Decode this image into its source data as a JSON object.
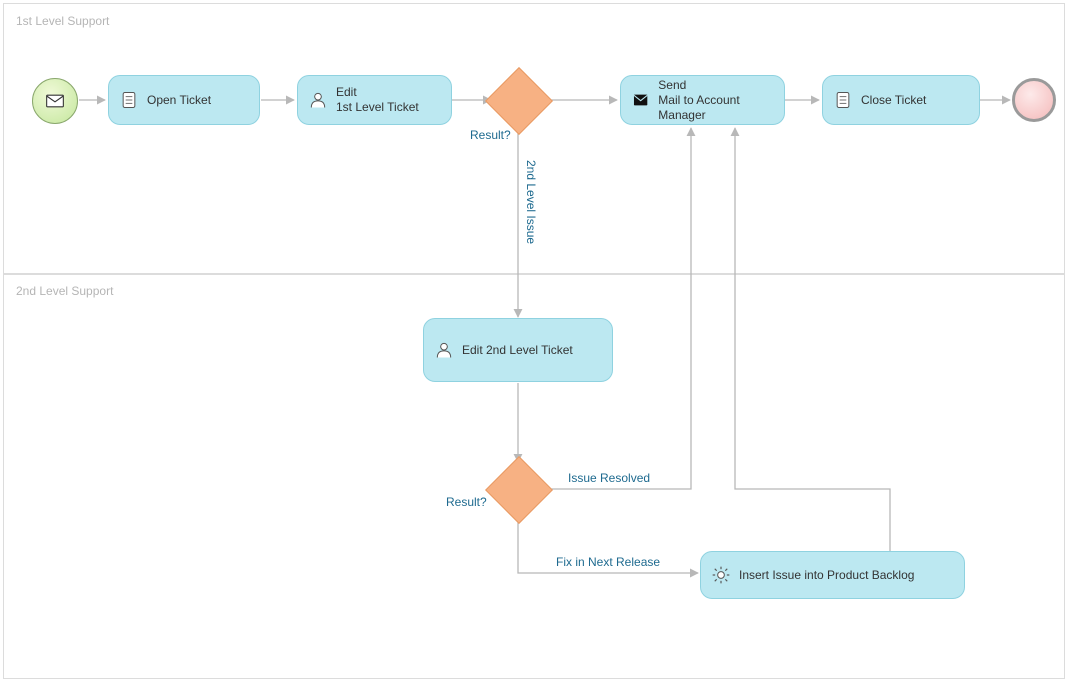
{
  "lanes": {
    "lane1": "1st Level Support",
    "lane2": "2nd Level Support"
  },
  "tasks": {
    "openTicket": "Open Ticket",
    "edit1st": "Edit\n1st Level Ticket",
    "sendMail": "Send\nMail to Account Manager",
    "closeTicket": "Close Ticket",
    "edit2nd": "Edit 2nd Level Ticket",
    "insertBacklog": "Insert Issue into Product Backlog"
  },
  "gateways": {
    "result1": "Result?",
    "result2": "Result?"
  },
  "flowLabels": {
    "secondLevelIssue": "2nd Level Issue",
    "issueResolved": "Issue Resolved",
    "fixNext": "Fix in Next Release"
  },
  "chart_data": {
    "type": "bpmn_diagram",
    "lanes": [
      {
        "id": "lane1",
        "name": "1st Level Support"
      },
      {
        "id": "lane2",
        "name": "2nd Level Support"
      }
    ],
    "nodes": [
      {
        "id": "start",
        "type": "startEvent",
        "subtype": "message",
        "lane": "lane1"
      },
      {
        "id": "openTicket",
        "type": "userTask",
        "label": "Open Ticket",
        "lane": "lane1"
      },
      {
        "id": "edit1st",
        "type": "userTask",
        "label": "Edit 1st Level Ticket",
        "lane": "lane1"
      },
      {
        "id": "gw1",
        "type": "exclusiveGateway",
        "label": "Result?",
        "lane": "lane1"
      },
      {
        "id": "sendMail",
        "type": "sendTask",
        "label": "Send Mail to Account Manager",
        "lane": "lane1"
      },
      {
        "id": "closeTicket",
        "type": "userTask",
        "label": "Close Ticket",
        "lane": "lane1"
      },
      {
        "id": "end",
        "type": "endEvent",
        "lane": "lane1"
      },
      {
        "id": "edit2nd",
        "type": "userTask",
        "label": "Edit 2nd Level Ticket",
        "lane": "lane2"
      },
      {
        "id": "gw2",
        "type": "exclusiveGateway",
        "label": "Result?",
        "lane": "lane2"
      },
      {
        "id": "insertBacklog",
        "type": "serviceTask",
        "label": "Insert Issue into Product Backlog",
        "lane": "lane2"
      }
    ],
    "flows": [
      {
        "from": "start",
        "to": "openTicket"
      },
      {
        "from": "openTicket",
        "to": "edit1st"
      },
      {
        "from": "edit1st",
        "to": "gw1"
      },
      {
        "from": "gw1",
        "to": "sendMail"
      },
      {
        "from": "gw1",
        "to": "edit2nd",
        "label": "2nd Level Issue"
      },
      {
        "from": "sendMail",
        "to": "closeTicket"
      },
      {
        "from": "closeTicket",
        "to": "end"
      },
      {
        "from": "edit2nd",
        "to": "gw2"
      },
      {
        "from": "gw2",
        "to": "sendMail",
        "label": "Issue Resolved"
      },
      {
        "from": "gw2",
        "to": "insertBacklog",
        "label": "Fix in Next Release"
      },
      {
        "from": "insertBacklog",
        "to": "sendMail"
      }
    ]
  }
}
